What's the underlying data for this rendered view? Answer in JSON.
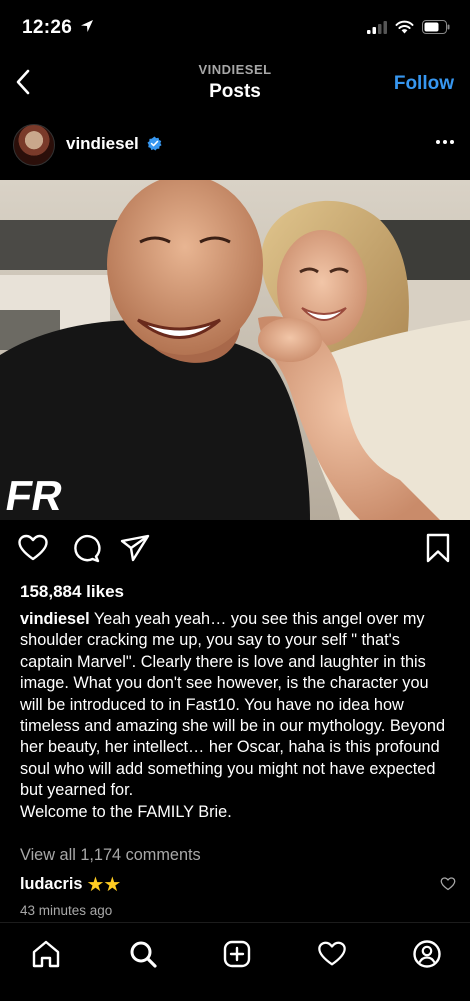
{
  "status": {
    "time": "12:26"
  },
  "nav": {
    "subtitle": "VINDIESEL",
    "title": "Posts",
    "follow_label": "Follow"
  },
  "post": {
    "username": "vindiesel",
    "likes": "158,884 likes",
    "caption_user": "vindiesel",
    "caption_text": " Yeah yeah yeah… you see this angel over my shoulder cracking me up, you say to your self \" that's captain Marvel\". Clearly there is love and laughter in this image. What you don't see however, is the character you will be introduced to in Fast10. You have no idea how timeless and amazing she will be in our mythology.  Beyond her beauty, her intellect… her Oscar, haha is this profound soul who will add something you might not have expected but yearned for.\nWelcome to the FAMILY Brie.",
    "view_comments": "View all 1,174 comments",
    "comment": {
      "user": "ludacris",
      "text": "★★"
    },
    "timestamp": "43 minutes ago",
    "shirt_text": "FR"
  },
  "colors": {
    "accent": "#3797f0",
    "background": "#000000",
    "muted": "#a8a8a8",
    "star": "#ffcc22"
  },
  "icons": [
    "location-arrow-icon",
    "signal-icon",
    "wifi-icon",
    "battery-icon",
    "back-chevron-icon",
    "verified-badge-icon",
    "more-dots-icon",
    "heart-icon",
    "comment-icon",
    "share-icon",
    "bookmark-icon",
    "home-icon",
    "search-icon",
    "create-icon",
    "activity-heart-icon",
    "profile-icon"
  ]
}
